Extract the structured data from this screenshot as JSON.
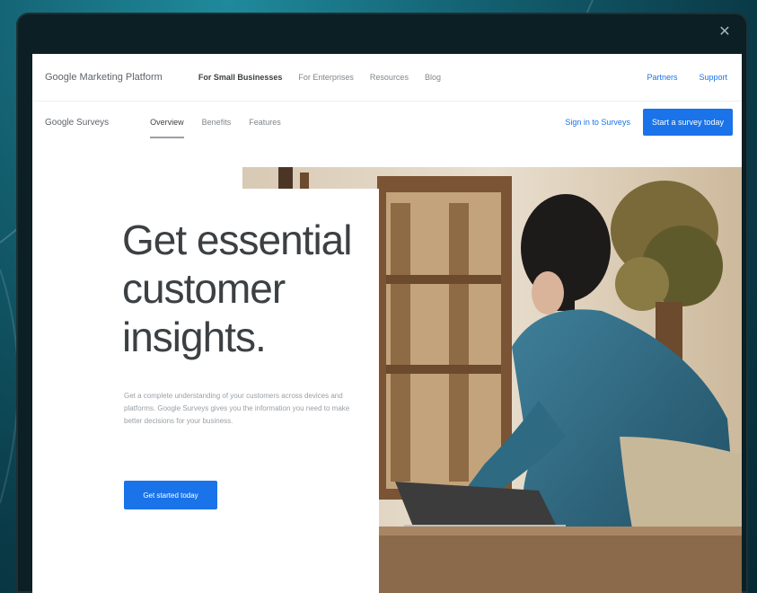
{
  "window": {
    "close_glyph": "✕"
  },
  "nav": {
    "brand": "Google Marketing Platform",
    "links": [
      {
        "label": "For Small Businesses",
        "active": true
      },
      {
        "label": "For Enterprises",
        "active": false
      },
      {
        "label": "Resources",
        "active": false
      },
      {
        "label": "Blog",
        "active": false
      }
    ],
    "right_links": [
      "Partners",
      "Support"
    ]
  },
  "subnav": {
    "product": "Google Surveys",
    "tabs": [
      {
        "label": "Overview",
        "active": true
      },
      {
        "label": "Benefits",
        "active": false
      },
      {
        "label": "Features",
        "active": false
      }
    ],
    "signin_label": "Sign in to Surveys",
    "cta_label": "Start a survey today"
  },
  "hero": {
    "title": "Get essential customer insights.",
    "body": "Get a complete understanding of your customers across devices and platforms. Google Surveys gives you the information you need to make better decisions for your business.",
    "button_label": "Get started today"
  },
  "colors": {
    "accent": "#1a73e8",
    "backdrop": "#135f6f"
  },
  "icons": [
    "close-icon"
  ]
}
